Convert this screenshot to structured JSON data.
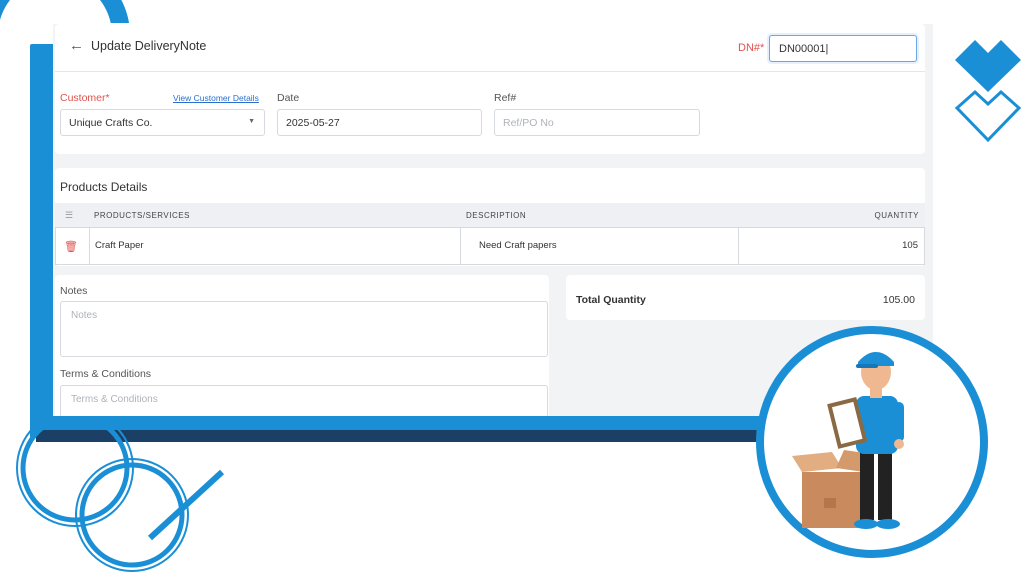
{
  "header": {
    "title": "Update DeliveryNote",
    "dn_label": "DN#",
    "dn_required": "*",
    "dn_value": "DN00001"
  },
  "form": {
    "customer_label": "Customer",
    "customer_required": "*",
    "view_customer_link": "View Customer Details",
    "customer_value": "Unique Crafts Co.",
    "date_label": "Date",
    "date_value": "2025-05-27",
    "ref_label": "Ref#",
    "ref_placeholder": "Ref/PO No"
  },
  "products": {
    "title": "Products Details",
    "columns": [
      "PRODUCTS/SERVICES",
      "DESCRIPTION",
      "QUANTITY"
    ],
    "rows": [
      {
        "product": "Craft Paper",
        "description": "Need Craft papers",
        "quantity": "105"
      }
    ]
  },
  "notes": {
    "label": "Notes",
    "placeholder": "Notes",
    "terms_label": "Terms & Conditions",
    "terms_placeholder": "Terms & Conditions"
  },
  "totals": {
    "label": "Total Quantity",
    "value": "105.00"
  },
  "colors": {
    "accent": "#1b8fd6",
    "required": "#e0524d",
    "link": "#2a6fcf"
  },
  "icons": [
    "back-arrow-icon",
    "chevron-down-icon",
    "drag-grip-icon",
    "trash-icon"
  ]
}
